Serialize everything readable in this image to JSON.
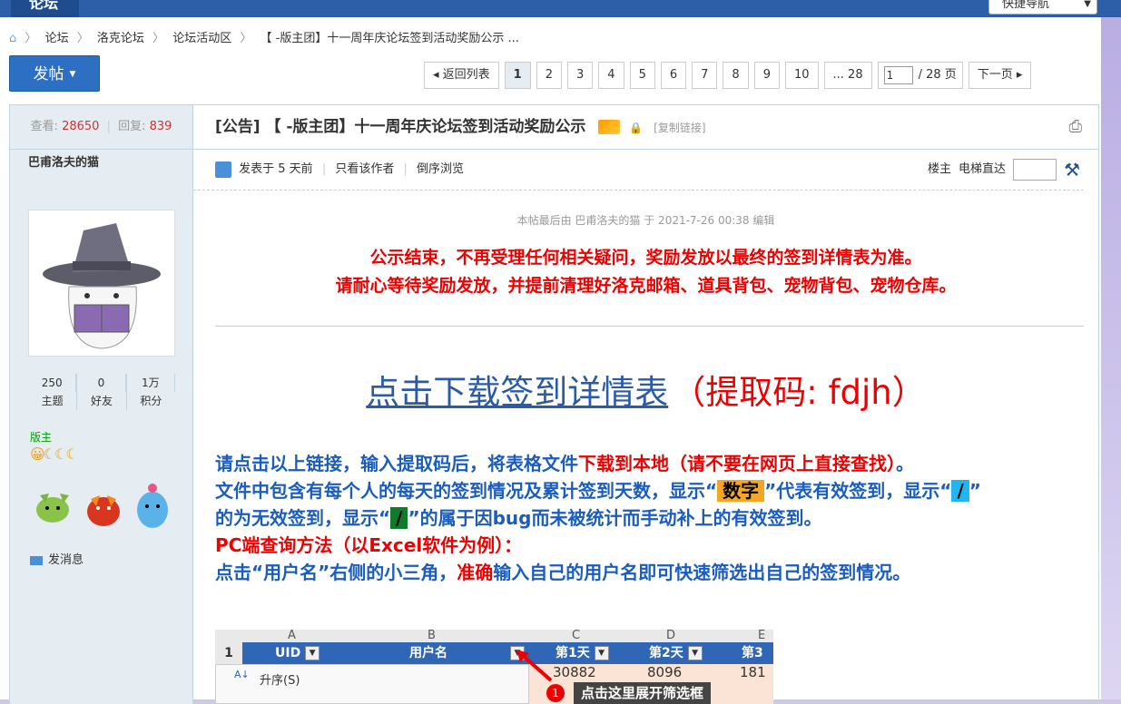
{
  "topbar": {
    "logo": "论坛",
    "quicknav": "快捷导航",
    "quicknav_arrow": "▼"
  },
  "breadcrumb": {
    "home": "⌂",
    "items": [
      "论坛",
      "洛克论坛",
      "论坛活动区",
      "【 -版主团】十一周年庆论坛签到活动奖励公示 ..."
    ]
  },
  "post_button": {
    "label": "发帖",
    "caret": "▼"
  },
  "pager": {
    "back": "◂ 返回列表",
    "pages": [
      "1",
      "2",
      "3",
      "4",
      "5",
      "6",
      "7",
      "8",
      "9",
      "10",
      "... 28"
    ],
    "current": "1",
    "input_value": "1",
    "total": "/ 28 页",
    "next": "下一页 ▸"
  },
  "sidebar": {
    "views_label": "查看:",
    "views": "28650",
    "replies_label": "回复:",
    "replies": "839",
    "author": "巴甫洛夫的猫",
    "stats": [
      {
        "value": "250",
        "label": "主题"
      },
      {
        "value": "0",
        "label": "好友"
      },
      {
        "value": "1万",
        "label": "积分"
      }
    ],
    "role": "版主",
    "medals": "😀☾☾☾",
    "send_message": "发消息"
  },
  "thread": {
    "title": "[公告] 【 -版主团】十一周年庆论坛签到活动奖励公示",
    "copy_link": "[复制链接]",
    "posted": "发表于 5 天前",
    "author_only": "只看该作者",
    "reverse": "倒序浏览",
    "floor_owner": "楼主",
    "elevator": "电梯直达"
  },
  "post": {
    "edited": "本帖最后由 巴甫洛夫的猫 于 2021-7-26 00:38 编辑",
    "notice_1": "公示结束，不再受理任何相关疑问，奖励发放以最终的签到详情表为准。",
    "notice_2": "请耐心等待奖励发放，并提前清理好洛克邮箱、道具背包、宠物背包、宠物仓库。",
    "download_link": "点击下载签到详情表",
    "code": "（提取码: fdjh）",
    "p1_a": "请点击以上链接，输入提取码后，将表格文件",
    "p1_b": "下载到本地（请不要在网页上直接查找）",
    "p1_c": "。",
    "p2_a": "文件中包含有每个人的每天的签到情况及累计签到天数，显示“",
    "p2_num": "数字",
    "p2_b": "”代表有效签到，显示“",
    "p2_slash": "/",
    "p2_c": "”",
    "p3_a": "的为无效签到，显示“",
    "p3_slash": "/",
    "p3_b": "”的属于因bug而未被统计而手动补上的有效签到。",
    "p4": "PC端查询方法（以Excel软件为例）：",
    "p5_a": "点击“用户名”右侧的小三角，",
    "p5_b": "准确",
    "p5_c": "输入自己的用户名即可快速筛选出自己的签到情况。"
  },
  "sheet": {
    "cols": [
      "A",
      "B",
      "C",
      "D",
      "E"
    ],
    "row1": "1",
    "headers": [
      "UID",
      "用户名",
      "第1天",
      "第2天",
      "第3"
    ],
    "sort_asc": "升序(S)",
    "cells": [
      "30882",
      "8096",
      "181"
    ],
    "tip_num": "1",
    "tip": "点击这里展开筛选框"
  }
}
